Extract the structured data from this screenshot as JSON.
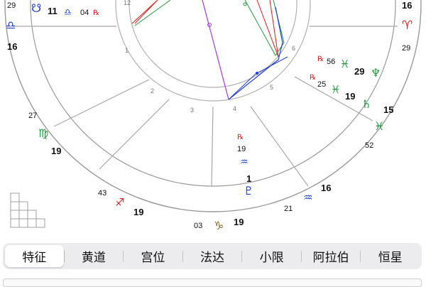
{
  "tabs": [
    {
      "label": "特征",
      "active": true
    },
    {
      "label": "黄道",
      "active": false
    },
    {
      "label": "宫位",
      "active": false
    },
    {
      "label": "法达",
      "active": false
    },
    {
      "label": "小限",
      "active": false
    },
    {
      "label": "阿拉伯",
      "active": false
    },
    {
      "label": "恒星",
      "active": false
    }
  ],
  "chart": {
    "house_numbers": [
      "12",
      "1",
      "2",
      "3",
      "4",
      "5",
      "6"
    ],
    "cusp_degrees": {
      "top_left": "29",
      "left": "16",
      "left_lower": "27",
      "virgo": "19",
      "lower_left": "43",
      "sagittarius": "19",
      "bottom": "03",
      "capricorn": "19",
      "lower_right": "21",
      "aquarius": "16",
      "right_lower": "52",
      "pisces": "15",
      "right_mid": "29",
      "right_top": "16"
    },
    "planets": {
      "node_deg": "11",
      "libra_deg": "04",
      "retro_mark": "℞",
      "neptune_min": "56",
      "neptune_deg": "29",
      "saturn_min": "25",
      "saturn_deg": "19",
      "center_deg": "19",
      "pluto_deg": "1"
    },
    "glyphs": {
      "node": "☋",
      "libra": "♎",
      "aries": "♈",
      "virgo": "♍",
      "sagittarius": "♐",
      "capricorn": "♑",
      "aquarius": "♒",
      "pisces": "♓",
      "neptune": "♆",
      "saturn": "♄",
      "pluto": "♇"
    },
    "colors": {
      "blue": "#1f3fd1",
      "red": "#d62020",
      "green": "#1f9a3b",
      "purple": "#a23fd0",
      "line": "#909090"
    }
  }
}
